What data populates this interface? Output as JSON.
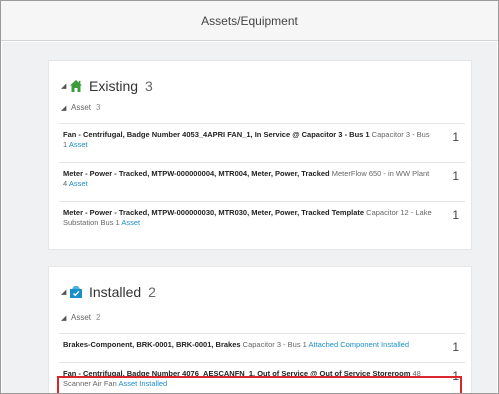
{
  "header": {
    "title": "Assets/Equipment"
  },
  "sections": [
    {
      "title": "Existing",
      "count": "3",
      "icon": "house-icon",
      "group": {
        "label": "Asset",
        "count": "3"
      },
      "rows": [
        {
          "bold": "Fan - Centrifugal, Badge Number 4053_4APRI FAN_1, In Service @ Capacitor 3 - Bus 1",
          "desc": " Capacitor 3 - Bus 1 ",
          "link": "Asset",
          "qty": "1"
        },
        {
          "bold": "Meter - Power - Tracked, MTPW-000000004, MTR004, Meter, Power, Tracked",
          "desc": " MeterFlow 650 - in WW Plant 4 ",
          "link": "Asset",
          "qty": "1"
        },
        {
          "bold": "Meter - Power - Tracked, MTPW-000000030, MTR030, Meter, Power, Tracked Template",
          "desc": " Capacitor 12 - Lake Substation Bus 1 ",
          "link": "Asset",
          "qty": "1"
        }
      ]
    },
    {
      "title": "Installed",
      "count": "2",
      "icon": "box-icon",
      "group": {
        "label": "Asset",
        "count": "2"
      },
      "rows": [
        {
          "bold": "Brakes-Component, BRK-0001, BRK-0001, Brakes",
          "desc": " Capacitor 3 - Bus 1 ",
          "link": "Attached Component Installed",
          "qty": "1"
        },
        {
          "bold": "Fan - Centrifugal, Badge Number 4076_AESCANFN_1, Out of Service @ Out of Service Storeroom",
          "desc": " 48 Scanner Air Fan ",
          "link": "Asset Installed",
          "qty": "1"
        }
      ]
    }
  ],
  "colors": {
    "accent": "#1a8fc9",
    "highlight": "#d9262c",
    "existing_icon": "#3d9a3d",
    "installed_icon": "#1a8fc9"
  }
}
